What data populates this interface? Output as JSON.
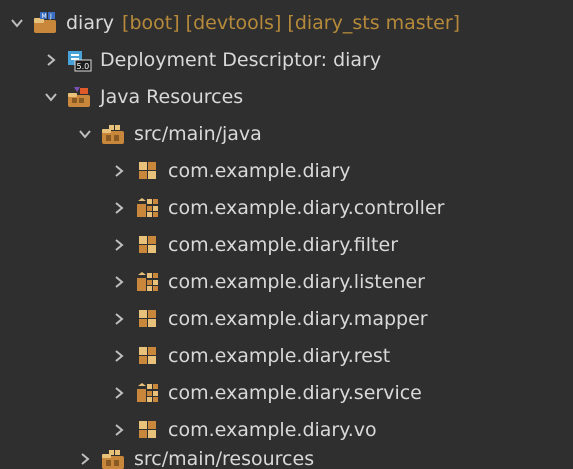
{
  "project": {
    "name": "diary",
    "decoration": "[boot] [devtools] [diary_sts master]",
    "icon": "project-icon"
  },
  "nodes": {
    "deployment_descriptor": {
      "label": "Deployment Descriptor: diary",
      "icon": "deployment-descriptor-icon"
    },
    "java_resources": {
      "label": "Java Resources",
      "icon": "java-resources-icon"
    },
    "src_main_java": {
      "label": "src/main/java",
      "icon": "source-folder-icon"
    },
    "src_main_resources": {
      "label": "src/main/resources",
      "icon": "source-folder-icon"
    }
  },
  "packages": [
    {
      "label": "com.example.diary",
      "icon": "package-icon"
    },
    {
      "label": "com.example.diary.controller",
      "icon": "package-group-icon"
    },
    {
      "label": "com.example.diary.filter",
      "icon": "package-icon"
    },
    {
      "label": "com.example.diary.listener",
      "icon": "package-group-icon"
    },
    {
      "label": "com.example.diary.mapper",
      "icon": "package-icon"
    },
    {
      "label": "com.example.diary.rest",
      "icon": "package-icon"
    },
    {
      "label": "com.example.diary.service",
      "icon": "package-group-icon"
    },
    {
      "label": "com.example.diary.vo",
      "icon": "package-icon"
    }
  ],
  "colors": {
    "background": "#2f2f2f",
    "text": "#d9d9d9",
    "decoration": "#b68a3a",
    "chevron": "#bfbfbf",
    "package_brown": "#c9873c",
    "package_light": "#e8c27a"
  }
}
